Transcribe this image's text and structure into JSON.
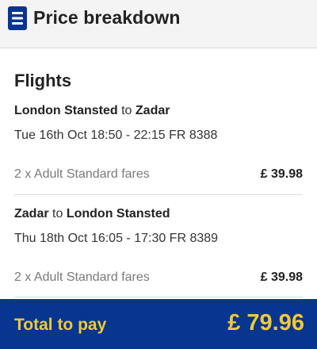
{
  "header": {
    "title": "Price breakdown",
    "icon": "receipt-list-icon"
  },
  "section": {
    "title": "Flights"
  },
  "flights": [
    {
      "origin": "London Stansted",
      "connector": "to",
      "destination": "Zadar",
      "details": "Tue 16th Oct 18:50 - 22:15 FR 8388",
      "fare_label": "2 x Adult Standard fares",
      "fare_price": "£ 39.98"
    },
    {
      "origin": "Zadar",
      "connector": "to",
      "destination": "London Stansted",
      "details": "Thu 18th Oct 16:05 - 17:30 FR 8389",
      "fare_label": "2 x Adult Standard fares",
      "fare_price": "£ 39.98"
    }
  ],
  "total": {
    "label": "Total to pay",
    "value": "£ 79.96"
  },
  "colors": {
    "brand_blue": "#073590",
    "accent_yellow": "#f1c933"
  }
}
